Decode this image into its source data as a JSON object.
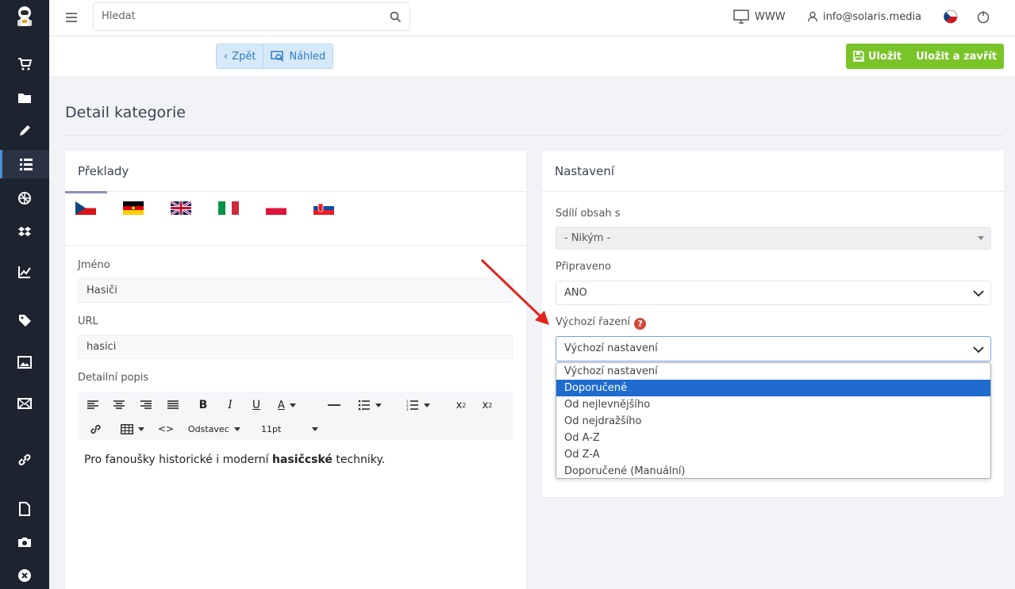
{
  "topbar": {
    "search_placeholder": "Hledat",
    "www_label": "WWW",
    "user_email": "info@solaris.media"
  },
  "actionbar": {
    "back_label": "Zpět",
    "preview_label": "Náhled",
    "save_label": "Uložit",
    "save_close_label": "Uložit a zavřít"
  },
  "page": {
    "title": "Detail kategorie"
  },
  "translations": {
    "heading": "Překlady",
    "flags": [
      "cz-flag-icon",
      "de-flag-icon",
      "gb-flag-icon",
      "it-flag-icon",
      "pl-flag-icon",
      "sk-flag-icon"
    ],
    "name_label": "Jméno",
    "name_value": "Hasiči",
    "url_label": "URL",
    "url_value": "hasici",
    "desc_label": "Detailní popis",
    "desc_before": "Pro fanoušky historické i moderní ",
    "desc_bold": "hasičcské",
    "desc_after": " techniky.",
    "paragraph_format": "Odstavec",
    "font_size": "11pt"
  },
  "settings": {
    "heading": "Nastavení",
    "shares_label": "Sdílí obsah s",
    "shares_value": "- Nikým -",
    "ready_label": "Připraveno",
    "ready_value": "ANO",
    "sort_label": "Výchozí řazení",
    "sort_value": "Výchozí nastavení",
    "sort_options": [
      "Výchozí nastavení",
      "Doporučené",
      "Od nejlevnějšího",
      "Od nejdražšího",
      "Od A-Z",
      "Od Z-A",
      "Doporučené (Manuální)"
    ],
    "sort_highlighted": "Doporučené"
  },
  "colors": {
    "sidebar": "#1e2330",
    "save_green": "#79c428",
    "highlight_blue": "#1f6bd0",
    "arrow_red": "#e0261c"
  }
}
